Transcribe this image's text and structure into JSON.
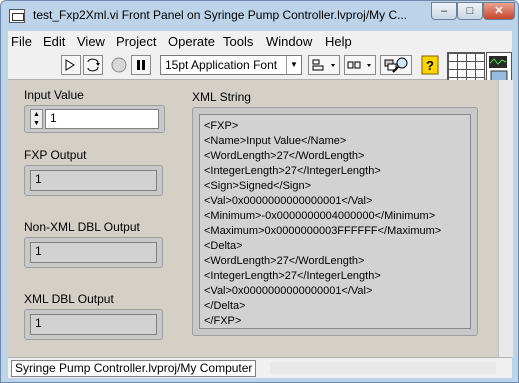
{
  "window": {
    "title": "test_Fxp2Xml.vi Front Panel on Syringe Pump Controller.lvproj/My C...",
    "minimize": "–",
    "maximize": "□",
    "close": "✕"
  },
  "menu": [
    "File",
    "Edit",
    "View",
    "Project",
    "Operate",
    "Tools",
    "Window",
    "Help"
  ],
  "toolbar": {
    "font": "15pt Application Font",
    "icons": [
      "run-arrow-icon",
      "run-continuously-icon",
      "abort-icon",
      "pause-icon",
      "font-dropdown",
      "align-icon",
      "distribute-icon",
      "search-icon",
      "help-icon"
    ]
  },
  "panel": {
    "input_value": {
      "label": "Input Value",
      "value": "1"
    },
    "fxp_output": {
      "label": "FXP Output",
      "value": "1"
    },
    "non_xml_dbl": {
      "label": "Non-XML DBL Output",
      "value": "1"
    },
    "xml_dbl": {
      "label": "XML DBL Output",
      "value": "1"
    },
    "xml_string": {
      "label": "XML String",
      "text": "<FXP>\n<Name>Input Value</Name>\n<WordLength>27</WordLength>\n<IntegerLength>27</IntegerLength>\n<Sign>Signed</Sign>\n<Val>0x0000000000000001</Val>\n<Minimum>-0x0000000004000000</Minimum>\n<Maximum>0x0000000003FFFFFF</Maximum>\n<Delta>\n<WordLength>27</WordLength>\n<IntegerLength>27</IntegerLength>\n<Val>0x0000000000000001</Val>\n</Delta>\n</FXP>"
    }
  },
  "status": {
    "context": "Syringe Pump Controller.lvproj/My Computer"
  }
}
